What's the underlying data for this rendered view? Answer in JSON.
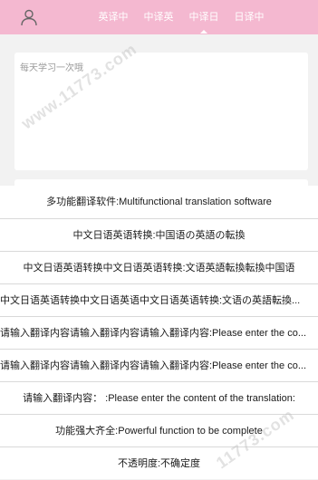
{
  "header": {
    "avatar_icon": "user-icon",
    "tabs": [
      {
        "label": "英译中"
      },
      {
        "label": "中译英"
      },
      {
        "label": "中译日"
      },
      {
        "label": "日译中"
      }
    ],
    "active_tab": 2,
    "background_color": "#f4b8d0"
  },
  "input": {
    "placeholder": "每天学习一次哦",
    "value": ""
  },
  "menu": {
    "items": [
      {
        "label": "多功能翻译软件:Multifunctional translation software"
      },
      {
        "label": "中文日语英语转换:中国语の英語の転換"
      },
      {
        "label": "中文日语英语转换中文日语英语转换:文语英語転換転換中国语"
      },
      {
        "label": "中文日语英语转换中文日语英语中文日语英语转换:文语の英語転換..."
      },
      {
        "label": "请输入翻译内容请输入翻译内容请输入翻译内容:Please enter the co..."
      },
      {
        "label": "请输入翻译内容请输入翻译内容请输入翻译内容:Please enter the co..."
      },
      {
        "label": "请输入翻译内容： :Please enter the content of the translation:"
      },
      {
        "label": "功能强大齐全:Powerful function to be complete"
      },
      {
        "label": "不透明度:不确定度"
      }
    ]
  },
  "watermark": {
    "text_1": "www.11773.com",
    "text_2": "11773.com"
  }
}
